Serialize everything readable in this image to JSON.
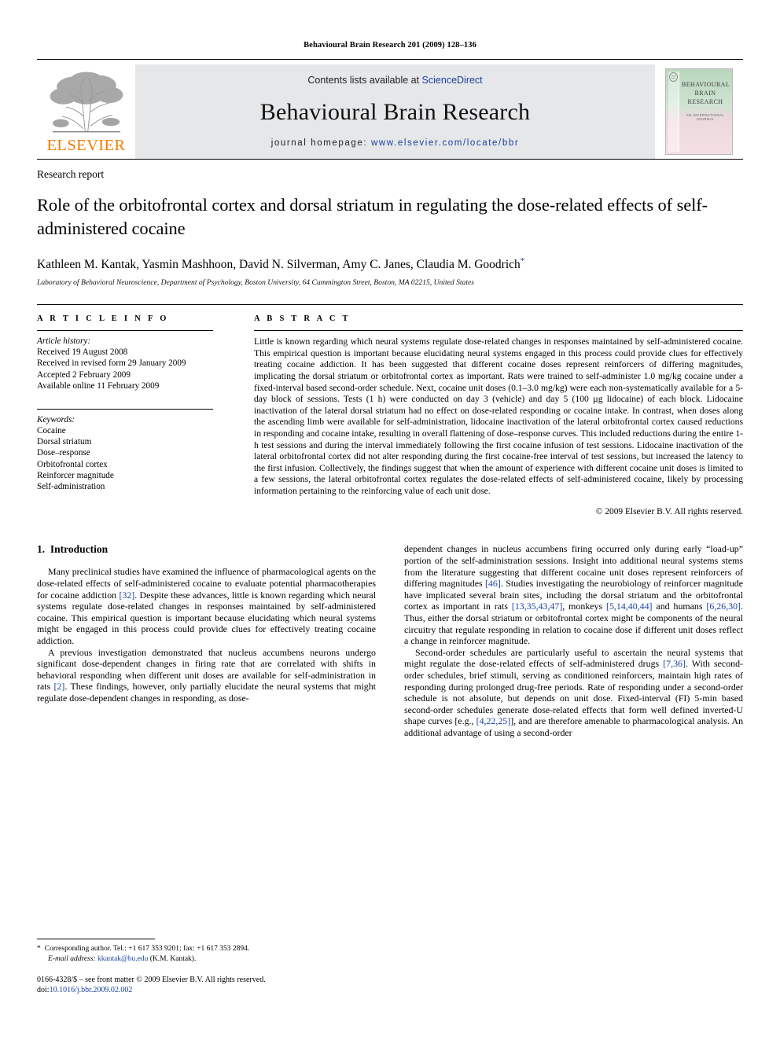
{
  "running_head": "Behavioural Brain Research 201 (2009) 128–136",
  "masthead": {
    "contents_prefix": "Contents lists available at ",
    "sciencedirect": "ScienceDirect",
    "journal_title": "Behavioural Brain Research",
    "homepage_label": "journal homepage:",
    "homepage_url": "www.elsevier.com/locate/bbr",
    "publisher_logo_text": "ELSEVIER",
    "cover": {
      "line1": "BEHAVIOURAL",
      "line2": "BRAIN",
      "line3": "RESEARCH",
      "subtitle": "AN INTERNATIONAL JOURNAL"
    }
  },
  "article": {
    "kind": "Research report",
    "title": "Role of the orbitofrontal cortex and dorsal striatum in regulating the dose-related effects of self-administered cocaine",
    "authors": "Kathleen M. Kantak, Yasmin Mashhoon, David N. Silverman, Amy C. Janes, Claudia M. Goodrich",
    "author_marker": "*",
    "affiliation": "Laboratory of Behavioral Neuroscience, Department of Psychology, Boston University, 64 Cummington Street, Boston, MA 02215, United States"
  },
  "article_info": {
    "heading": "A R T I C L E   I N F O",
    "history_label": "Article history:",
    "history": [
      "Received 19 August 2008",
      "Received in revised form 29 January 2009",
      "Accepted 2 February 2009",
      "Available online 11 February 2009"
    ],
    "keywords_label": "Keywords:",
    "keywords": [
      "Cocaine",
      "Dorsal striatum",
      "Dose–response",
      "Orbitofrontal cortex",
      "Reinforcer magnitude",
      "Self-administration"
    ]
  },
  "abstract": {
    "heading": "A B S T R A C T",
    "text": "Little is known regarding which neural systems regulate dose-related changes in responses maintained by self-administered cocaine. This empirical question is important because elucidating neural systems engaged in this process could provide clues for effectively treating cocaine addiction. It has been suggested that different cocaine doses represent reinforcers of differing magnitudes, implicating the dorsal striatum or orbitofrontal cortex as important. Rats were trained to self-administer 1.0 mg/kg cocaine under a fixed-interval based second-order schedule. Next, cocaine unit doses (0.1–3.0 mg/kg) were each non-systematically available for a 5-day block of sessions. Tests (1 h) were conducted on day 3 (vehicle) and day 5 (100 µg lidocaine) of each block. Lidocaine inactivation of the lateral dorsal striatum had no effect on dose-related responding or cocaine intake. In contrast, when doses along the ascending limb were available for self-administration, lidocaine inactivation of the lateral orbitofrontal cortex caused reductions in responding and cocaine intake, resulting in overall flattening of dose–response curves. This included reductions during the entire 1-h test sessions and during the interval immediately following the first cocaine infusion of test sessions. Lidocaine inactivation of the lateral orbitofrontal cortex did not alter responding during the first cocaine-free interval of test sessions, but increased the latency to the first infusion. Collectively, the findings suggest that when the amount of experience with different cocaine unit doses is limited to a few sessions, the lateral orbitofrontal cortex regulates the dose-related effects of self-administered cocaine, likely by processing information pertaining to the reinforcing value of each unit dose.",
    "copyright": "© 2009 Elsevier B.V. All rights reserved."
  },
  "body": {
    "section_number": "1.",
    "section_title": "Introduction",
    "left_paragraphs": [
      "Many preclinical studies have examined the influence of pharmacological agents on the dose-related effects of self-administered cocaine to evaluate potential pharmacotherapies for cocaine addiction [32]. Despite these advances, little is known regarding which neural systems regulate dose-related changes in responses maintained by self-administered cocaine. This empirical question is important because elucidating which neural systems might be engaged in this process could provide clues for effectively treating cocaine addiction.",
      "A previous investigation demonstrated that nucleus accumbens neurons undergo significant dose-dependent changes in firing rate that are correlated with shifts in behavioral responding when different unit doses are available for self-administration in rats [2]. These findings, however, only partially elucidate the neural systems that might regulate dose-dependent changes in responding, as dose-"
    ],
    "right_paragraphs": [
      "dependent changes in nucleus accumbens firing occurred only during early “load-up” portion of the self-administration sessions. Insight into additional neural systems stems from the literature suggesting that different cocaine unit doses represent reinforcers of differing magnitudes [46]. Studies investigating the neurobiology of reinforcer magnitude have implicated several brain sites, including the dorsal striatum and the orbitofrontal cortex as important in rats [13,35,43,47], monkeys [5,14,40,44] and humans [6,26,30]. Thus, either the dorsal striatum or orbitofrontal cortex might be components of the neural circuitry that regulate responding in relation to cocaine dose if different unit doses reflect a change in reinforcer magnitude.",
      "Second-order schedules are particularly useful to ascertain the neural systems that might regulate the dose-related effects of self-administered drugs [7,36]. With second-order schedules, brief stimuli, serving as conditioned reinforcers, maintain high rates of responding during prolonged drug-free periods. Rate of responding under a second-order schedule is not absolute, but depends on unit dose. Fixed-interval (FI) 5-min based second-order schedules generate dose-related effects that form well defined inverted-U shape curves [e.g., [4,22,25]], and are therefore amenable to pharmacological analysis. An additional advantage of using a second-order"
    ]
  },
  "footnotes": {
    "corresponding_marker": "*",
    "corresponding": "Corresponding author. Tel.: +1 617 353 9201; fax: +1 617 353 2894.",
    "email_label": "E-mail address:",
    "email": "kkantak@bu.edu",
    "email_suffix": "(K.M. Kantak).",
    "imprint": "0166-4328/$ – see front matter © 2009 Elsevier B.V. All rights reserved.",
    "doi_label": "doi:",
    "doi": "10.1016/j.bbr.2009.02.002"
  },
  "colors": {
    "link": "#1a3fa0",
    "elsevier_orange": "#f07d00",
    "band_grey": "#e6e7e9"
  }
}
